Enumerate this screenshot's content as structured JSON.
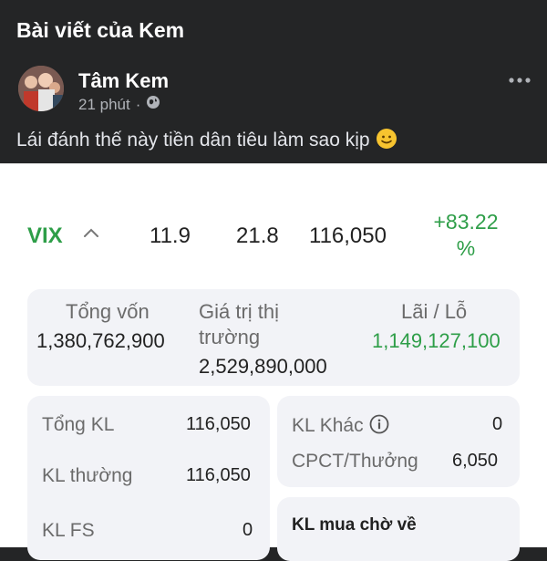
{
  "header": {
    "title": "Bài viết của Kem"
  },
  "post": {
    "author": "Tâm Kem",
    "time": "21 phút",
    "separator": "·",
    "text": "Lái đánh thế này tiền dân tiêu làm sao kịp",
    "emoji": "slightly-smiling-face",
    "more_icon": "more-horizontal-icon",
    "privacy_icon": "globe-icon"
  },
  "stock": {
    "ticker": "VIX",
    "col1": "11.9",
    "col2": "21.8",
    "col3": "116,050",
    "change_line1": "+83.22",
    "change_line2": "%"
  },
  "summary": {
    "total_capital_label": "Tổng vốn",
    "total_capital": "1,380,762,900",
    "market_value_label_1": "Giá trị thị",
    "market_value_label_2": "trường",
    "market_value": "2,529,890,000",
    "pnl_label": "Lãi / Lỗ",
    "pnl": "1,149,127,100"
  },
  "left_card": {
    "total_kl_label": "Tổng KL",
    "total_kl": "116,050",
    "kl_normal_label": "KL thường",
    "kl_normal": "116,050",
    "kl_fs_label": "KL FS",
    "kl_fs": "0"
  },
  "right_card": {
    "kl_other_label": "KL Khác",
    "kl_other": "0",
    "cpct_label": "CPCT/Thưởng",
    "cpct": "6,050",
    "kl_pending_label": "KL mua chờ về"
  },
  "colors": {
    "green": "#2e9e48",
    "dark_bg": "#242526",
    "card_bg": "#f2f3f7"
  }
}
